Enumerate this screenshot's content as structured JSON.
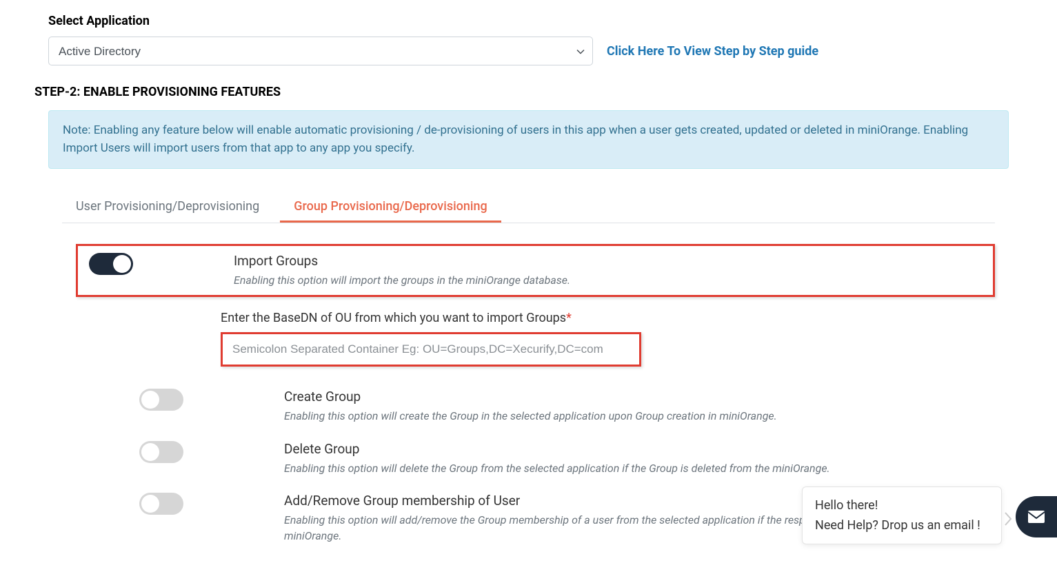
{
  "header": {
    "select_label": "Select Application",
    "select_value": "Active Directory",
    "guide_link": "Click Here To View Step by Step guide"
  },
  "step2": {
    "heading": "STEP-2: ENABLE PROVISIONING FEATURES",
    "note": "Note: Enabling any feature below will enable automatic provisioning / de-provisioning of users in this app when a user gets created, updated or deleted in miniOrange. Enabling Import Users will import users from that app to any app you specify."
  },
  "tabs": {
    "user": "User Provisioning/Deprovisioning",
    "group": "Group Provisioning/Deprovisioning"
  },
  "options": {
    "import_groups": {
      "title": "Import Groups",
      "desc": "Enabling this option will import the groups in the miniOrange database."
    },
    "basedn": {
      "label": "Enter the BaseDN of OU from which you want to import Groups",
      "placeholder": "Semicolon Separated Container Eg: OU=Groups,DC=Xecurify,DC=com"
    },
    "create_group": {
      "title": "Create Group",
      "desc": "Enabling this option will create the Group in the selected application upon Group creation in miniOrange."
    },
    "delete_group": {
      "title": "Delete Group",
      "desc": "Enabling this option will delete the Group from the selected application if the Group is deleted from the miniOrange."
    },
    "membership": {
      "title": "Add/Remove Group membership of User",
      "desc": "Enabling this option will add/remove the Group membership of a user from the selected application if the respective user is updated from the miniOrange."
    }
  },
  "chat": {
    "line1": "Hello there!",
    "line2": "Need Help? Drop us an email !"
  }
}
